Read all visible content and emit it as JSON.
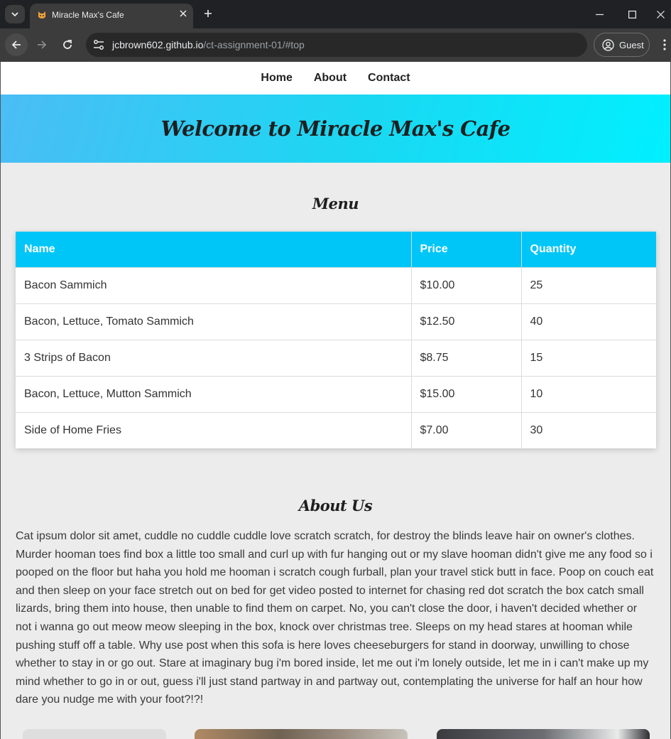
{
  "browser": {
    "tab_title": "Miracle Max's Cafe",
    "url_host": "jcbrown602.github.io",
    "url_path": "/ct-assignment-01/#top",
    "profile_label": "Guest"
  },
  "nav": {
    "links": [
      "Home",
      "About",
      "Contact"
    ]
  },
  "hero": {
    "title": "Welcome to Miracle Max's Cafe"
  },
  "menu": {
    "title": "Menu",
    "headers": [
      "Name",
      "Price",
      "Quantity"
    ],
    "rows": [
      [
        "Bacon Sammich",
        "$10.00",
        "25"
      ],
      [
        "Bacon, Lettuce, Tomato Sammich",
        "$12.50",
        "40"
      ],
      [
        "3 Strips of Bacon",
        "$8.75",
        "15"
      ],
      [
        "Bacon, Lettuce, Mutton Sammich",
        "$15.00",
        "10"
      ],
      [
        "Side of Home Fries",
        "$7.00",
        "30"
      ]
    ]
  },
  "about": {
    "title": "About Us",
    "text": "Cat ipsum dolor sit amet, cuddle no cuddle cuddle love scratch scratch, for destroy the blinds leave hair on owner's clothes. Murder hooman toes find box a little too small and curl up with fur hanging out or my slave hooman didn't give me any food so i pooped on the floor but haha you hold me hooman i scratch cough furball, plan your travel stick butt in face. Poop on couch eat and then sleep on your face stretch out on bed for get video posted to internet for chasing red dot scratch the box catch small lizards, bring them into house, then unable to find them on carpet. No, you can't close the door, i haven't decided whether or not i wanna go out meow meow sleeping in the box, knock over christmas tree. Sleeps on my head stares at hooman while pushing stuff off a table. Why use post when this sofa is here loves cheeseburgers for stand in doorway, unwilling to chose whether to stay in or go out. Stare at imaginary bug i'm bored inside, let me out i'm lonely outside, let me in i can't make up my mind whether to go in or out, guess i'll just stand partway in and partway out, contemplating the universe for half an hour how dare you nudge me with your foot?!?!"
  },
  "icons": {
    "favicon": "cat-face-icon",
    "site_info": "tune-icon"
  }
}
